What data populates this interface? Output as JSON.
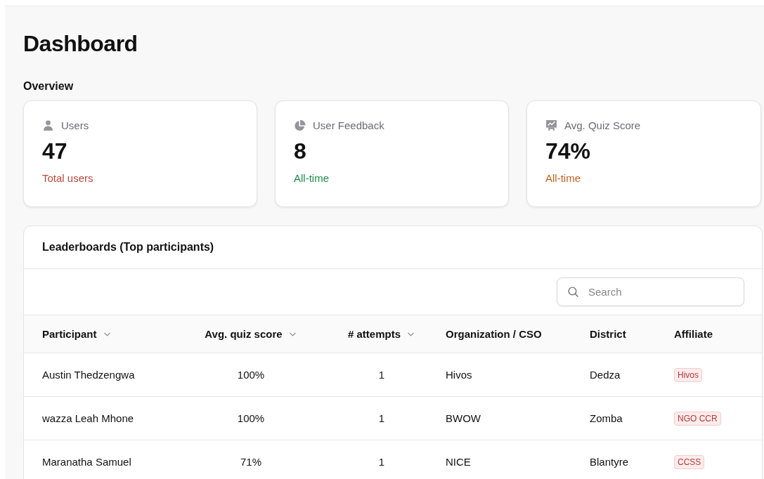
{
  "page": {
    "title": "Dashboard"
  },
  "overview": {
    "heading": "Overview",
    "cards": [
      {
        "kind": "user",
        "label": "Users",
        "value": "47",
        "note": "Total users",
        "color": "#b5483c"
      },
      {
        "kind": "pie",
        "label": "User Feedback",
        "value": "8",
        "note": "All-time",
        "color": "#1f8a4c"
      },
      {
        "kind": "board",
        "label": "Avg. Quiz Score",
        "value": "74%",
        "note": "All-time",
        "color": "#c0621f"
      }
    ]
  },
  "leaderboard": {
    "title": "Leaderboards (Top participants)",
    "search": {
      "placeholder": "Search"
    },
    "columns": [
      {
        "label": "Participant",
        "sortable": true
      },
      {
        "label": "Avg. quiz score",
        "sortable": true
      },
      {
        "label": "# attempts",
        "sortable": true
      },
      {
        "label": "Organization / CSO",
        "sortable": false
      },
      {
        "label": "District",
        "sortable": false
      },
      {
        "label": "Affiliate",
        "sortable": false
      }
    ],
    "rows": [
      {
        "participant": "Austin Thedzengwa",
        "score": "100%",
        "attempts": "1",
        "organization": "Hivos",
        "district": "Dedza",
        "affiliate": "Hivos"
      },
      {
        "participant": "wazza Leah Mhone",
        "score": "100%",
        "attempts": "1",
        "organization": "BWOW",
        "district": "Zomba",
        "affiliate": "NGO CCR"
      },
      {
        "participant": "Maranatha Samuel",
        "score": "71%",
        "attempts": "1",
        "organization": "NICE",
        "district": "Blantyre",
        "affiliate": "CCSS"
      }
    ]
  }
}
